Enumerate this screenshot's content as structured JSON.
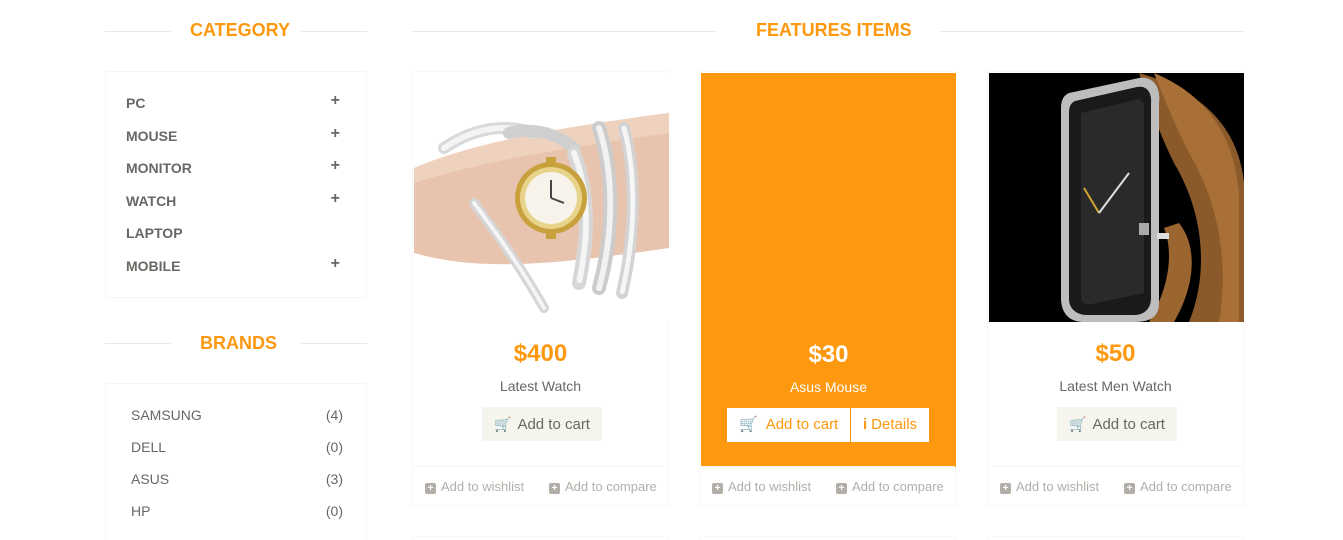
{
  "category": {
    "title": "Category",
    "items": [
      {
        "label": "PC",
        "expandable": "+"
      },
      {
        "label": "Mouse",
        "expandable": "+"
      },
      {
        "label": "Monitor",
        "expandable": "+"
      },
      {
        "label": "Watch",
        "expandable": "+"
      },
      {
        "label": "Laptop",
        "expandable": ""
      },
      {
        "label": "Mobile",
        "expandable": "+"
      }
    ]
  },
  "brands": {
    "title": "Brands",
    "items": [
      {
        "label": "SAMSUNG",
        "count": "(4)"
      },
      {
        "label": "DELL",
        "count": "(0)"
      },
      {
        "label": "ASUS",
        "count": "(3)"
      },
      {
        "label": "HP",
        "count": "(0)"
      }
    ]
  },
  "features": {
    "title": "Features Items",
    "products": [
      {
        "price": "$400",
        "name": "Latest Watch",
        "cart_label": "Add to cart",
        "wishlist": "Add to wishlist",
        "compare": "Add to compare"
      },
      {
        "price": "$30",
        "name": "Asus Mouse",
        "cart_label": "Add to cart",
        "details_label": "Details",
        "wishlist": "Add to wishlist",
        "compare": "Add to compare"
      },
      {
        "price": "$50",
        "name": "Latest Men Watch",
        "cart_label": "Add to cart",
        "wishlist": "Add to wishlist",
        "compare": "Add to compare"
      }
    ]
  },
  "icons": {
    "cart": "shopping-cart-icon",
    "plus": "plus-square-icon",
    "info": "info-icon"
  },
  "colors": {
    "accent": "#FE980F",
    "text": "#696763",
    "muted": "#B3AFA8",
    "button_bg": "#F5F5ED"
  }
}
